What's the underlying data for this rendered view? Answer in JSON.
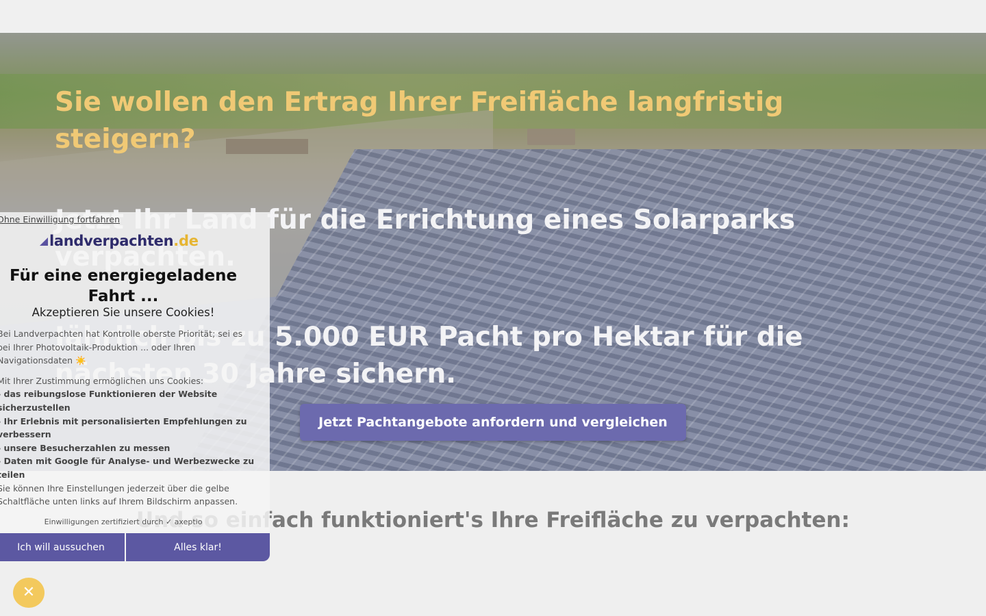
{
  "hero": {
    "headline1": "Sie wollen den Ertrag Ihrer Freifläche langfristig steigern?",
    "headline2": "Jetzt Ihr Land für die Errichtung eines Solarparks verpachten.",
    "headline3": "Jährlich bis zu 5.000 EUR Pacht pro Hektar für die nächsten 30 Jahre sichern.",
    "cta_label": "Jetzt Pachtangebote anfordern und vergleichen"
  },
  "section": {
    "title": "Und so einfach funktioniert's Ihre Freifläche zu verpachten:"
  },
  "cookie": {
    "skip_link": "Ohne Einwilligung fortfahren",
    "logo_name": "landverpachten",
    "logo_tld": ".de",
    "title": "Für eine energiegeladene Fahrt ...",
    "subtitle": "Akzeptieren Sie unsere Cookies!",
    "intro": "Bei Landverpachten hat Kontrolle oberste Priorität; sei es bei Ihrer Photovoltaik-Produktion ... oder Ihren Navigationsdaten ☀️",
    "purpose_intro": "Mit Ihrer Zustimmung ermöglichen uns Cookies:",
    "purposes": [
      "- das reibungslose Funktionieren der Website sicherzustellen",
      "- Ihr Erlebnis mit personalisierten Empfehlungen zu verbessern",
      "- unsere Besucherzahlen zu messen",
      "- Daten mit Google für Analyse- und Werbezwecke zu teilen"
    ],
    "settings_note": "Sie können Ihre Einstellungen jederzeit über die gelbe Schaltfläche unten links auf Ihrem Bildschirm anpassen.",
    "certified": "Einwilligungen zertifiziert durch ✓ axeptio",
    "btn_search": "Ich will aussuchen",
    "btn_ok": "Alles klar!"
  },
  "fab": {
    "icon": "close-icon",
    "symbol": "✕",
    "color": "#f3c95d"
  },
  "colors": {
    "accent": "#6c6aae",
    "headline_gold": "#f0c975",
    "button": "#5c58a2"
  }
}
